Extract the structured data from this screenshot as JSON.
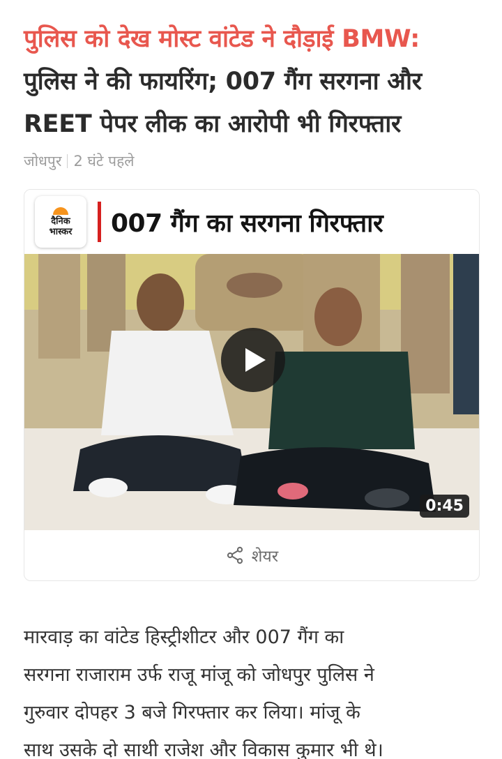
{
  "headline": {
    "red": "पुलिस को देख मोस्ट वांटेड ने दौड़ाई BMW:",
    "line2": "पुलिस ने की फायरिंग; 007 गैंग सरगना और",
    "line3": "REET पेपर लीक का आरोपी भी गिरफ्तार"
  },
  "meta": {
    "location": "जोधपुर",
    "time": "2 घंटे पहले"
  },
  "video": {
    "logo_line1": "दैनिक",
    "logo_line2": "भास्कर",
    "title": "007 गैंग का सरगना गिरफ्तार",
    "duration": "0:45",
    "play_icon": "play-icon"
  },
  "share": {
    "label": "शेयर",
    "icon": "share-icon"
  },
  "article": {
    "lines": [
      "मारवाड़ का वांटेड हिस्ट्रीशीटर और 007 गैंग का",
      "सरगना राजाराम उर्फ राजू मांजू को जोधपुर पुलिस ने",
      "गुरुवार दोपहर 3 बजे गिरफ्तार कर लिया। मांजू के",
      "साथ उसके दो साथी राजेश और विकास कुमार भी थे।"
    ]
  },
  "colors": {
    "headline_red": "#e8574e",
    "brand_red": "#d6201f",
    "brand_orange": "#f7941d"
  }
}
